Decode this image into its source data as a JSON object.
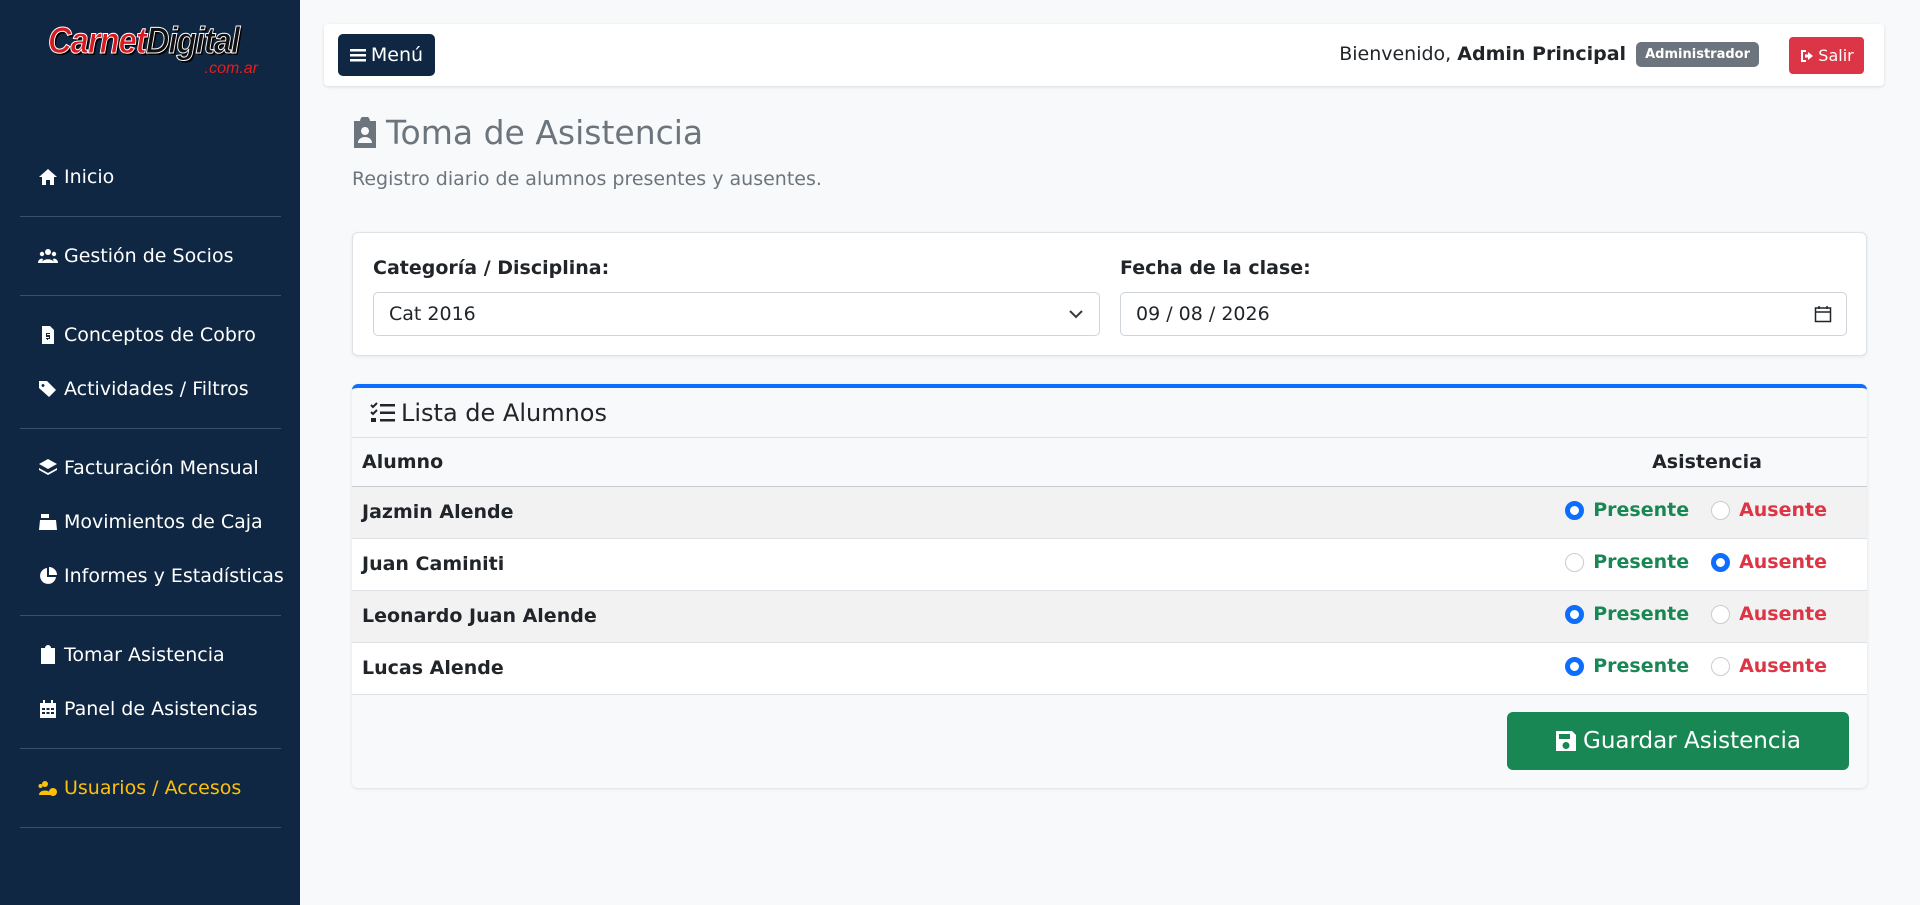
{
  "brand": {
    "name_part1": "Carnet",
    "name_part2": "Digital",
    "domain": ".com.ar"
  },
  "sidebar": {
    "items": [
      {
        "label": "Inicio",
        "icon": "home-icon"
      },
      {
        "label": "Gestión de Socios",
        "icon": "users-icon"
      },
      {
        "label": "Conceptos de Cobro",
        "icon": "invoice-icon"
      },
      {
        "label": "Actividades / Filtros",
        "icon": "tags-icon"
      },
      {
        "label": "Facturación Mensual",
        "icon": "layers-icon"
      },
      {
        "label": "Movimientos de Caja",
        "icon": "cash-register-icon"
      },
      {
        "label": "Informes y Estadísticas",
        "icon": "pie-chart-icon"
      },
      {
        "label": "Tomar Asistencia",
        "icon": "clipboard-user-icon"
      },
      {
        "label": "Panel de Asistencias",
        "icon": "calendar-icon"
      },
      {
        "label": "Usuarios / Accesos",
        "icon": "users-gear-icon",
        "active": true
      }
    ]
  },
  "topbar": {
    "menu_label": "Menú",
    "welcome_prefix": "Bienvenido,",
    "user_name": "Admin Principal",
    "role_badge": "Administrador",
    "logout_label": "Salir"
  },
  "page": {
    "title": "Toma de Asistencia",
    "subtitle": "Registro diario de alumnos presentes y ausentes."
  },
  "filters": {
    "category_label": "Categoría / Disciplina:",
    "category_value": "Cat 2016",
    "date_label": "Fecha de la clase:",
    "date_value": "09 / 08 / 2026"
  },
  "students_card": {
    "title": "Lista de Alumnos",
    "col_student": "Alumno",
    "col_attendance": "Asistencia",
    "present_label": "Presente",
    "absent_label": "Ausente",
    "rows": [
      {
        "name": "Jazmin Alende",
        "status": "Presente"
      },
      {
        "name": "Juan Caminiti",
        "status": "Ausente"
      },
      {
        "name": "Leonardo Juan Alende",
        "status": "Presente"
      },
      {
        "name": "Lucas Alende",
        "status": "Presente"
      }
    ],
    "save_label": "Guardar Asistencia"
  },
  "colors": {
    "sidebar_bg": "#0f2742",
    "primary": "#0d6efd",
    "success": "#198754",
    "danger": "#dc3545",
    "active_nav": "#ffc107"
  }
}
